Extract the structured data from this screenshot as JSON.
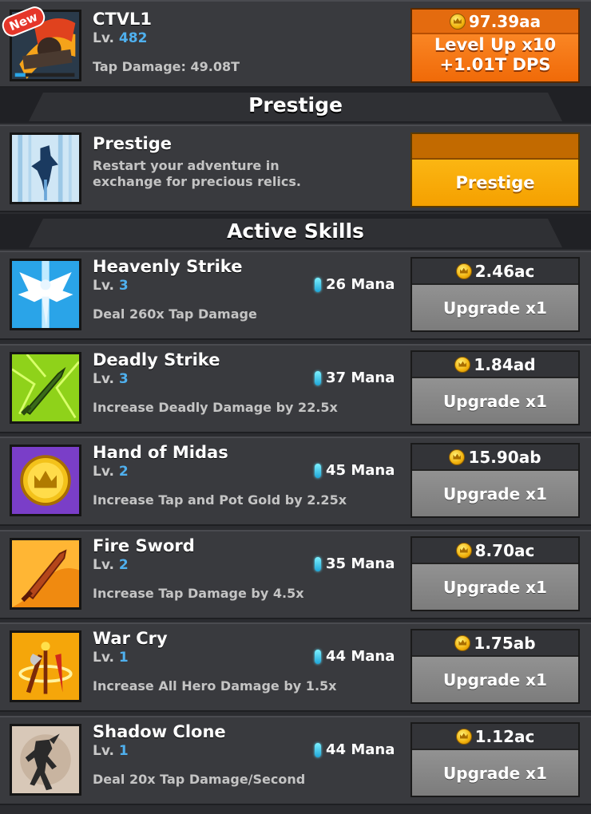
{
  "hero": {
    "name": "CTVL1",
    "level_prefix": "Lv. ",
    "level": "482",
    "tap_damage": "Tap Damage: 49.08T",
    "new_badge": "New",
    "level_up": {
      "cost": "97.39aa",
      "line1": "Level Up x10",
      "line2": "+1.01T DPS"
    }
  },
  "prestige_section": {
    "heading": "Prestige",
    "name": "Prestige",
    "description_line1": "Restart your adventure in",
    "description_line2": "exchange for precious relics.",
    "button_label": "Prestige"
  },
  "skills_section": {
    "heading": "Active Skills",
    "skills": [
      {
        "name": "Heavenly Strike",
        "level_prefix": "Lv. ",
        "level": "3",
        "mana": "26 Mana",
        "description": "Deal 260x Tap Damage",
        "cost": "2.46ac",
        "button": "Upgrade x1",
        "icon": "heavenly-strike-icon"
      },
      {
        "name": "Deadly Strike",
        "level_prefix": "Lv. ",
        "level": "3",
        "mana": "37 Mana",
        "description": "Increase Deadly Damage by 22.5x",
        "cost": "1.84ad",
        "button": "Upgrade x1",
        "icon": "deadly-strike-icon"
      },
      {
        "name": "Hand of Midas",
        "level_prefix": "Lv. ",
        "level": "2",
        "mana": "45 Mana",
        "description": "Increase Tap and Pot Gold by 2.25x",
        "cost": "15.90ab",
        "button": "Upgrade x1",
        "icon": "hand-of-midas-icon"
      },
      {
        "name": "Fire Sword",
        "level_prefix": "Lv. ",
        "level": "2",
        "mana": "35 Mana",
        "description": "Increase Tap Damage by 4.5x",
        "cost": "8.70ac",
        "button": "Upgrade x1",
        "icon": "fire-sword-icon"
      },
      {
        "name": "War Cry",
        "level_prefix": "Lv. ",
        "level": "1",
        "mana": "44 Mana",
        "description": "Increase All Hero Damage by 1.5x",
        "cost": "1.75ab",
        "button": "Upgrade x1",
        "icon": "war-cry-icon"
      },
      {
        "name": "Shadow Clone",
        "level_prefix": "Lv. ",
        "level": "1",
        "mana": "44 Mana",
        "description": "Deal 20x Tap Damage/Second",
        "cost": "1.12ac",
        "button": "Upgrade x1",
        "icon": "shadow-clone-icon"
      }
    ]
  },
  "colors": {
    "background": "#2b2c30",
    "row": "#393a3e",
    "level_number": "#4fb0ee",
    "level_up_button": "#f06a08",
    "prestige_button": "#f5a000",
    "upgrade_button": "#888888",
    "mana_crystal": "#1ea6d8"
  }
}
